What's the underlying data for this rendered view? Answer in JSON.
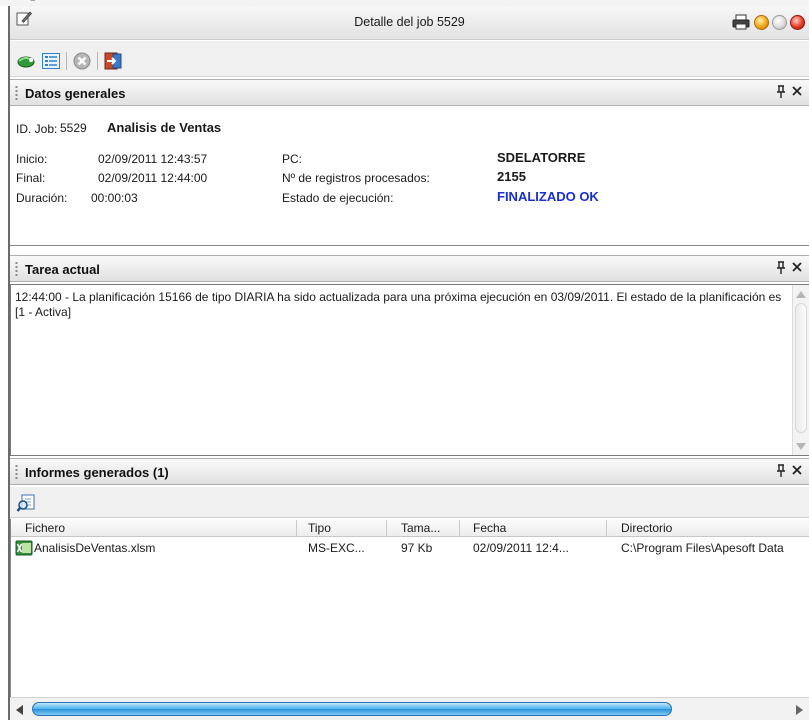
{
  "window": {
    "title": "Detalle del job 5529"
  },
  "toolbar": {
    "buttons": [
      "refresh-icon",
      "list-icon",
      "stop-icon",
      "exit-icon"
    ]
  },
  "datos_generales": {
    "header": "Datos generales",
    "id_job_label": "ID. Job:",
    "id_job_value": "5529",
    "job_name": "Analisis de Ventas",
    "inicio_label": "Inicio:",
    "inicio_value": "02/09/2011 12:43:57",
    "final_label": "Final:",
    "final_value": "02/09/2011 12:44:00",
    "duracion_label": "Duración:",
    "duracion_value": "00:00:03",
    "pc_label": "PC:",
    "pc_value": "SDELATORRE",
    "registros_label": "Nº de registros procesados:",
    "registros_value": "2155",
    "estado_label": "Estado de ejecución:",
    "estado_value": "FINALIZADO OK",
    "estado_color": "#1a2fd2"
  },
  "tarea_actual": {
    "header": "Tarea actual",
    "text": "12:44:00 -  La planificación 15166 de tipo DIARIA ha sido actualizada para una próxima ejecución en 03/09/2011. El estado de la planificación es [1 - Activa]"
  },
  "informes": {
    "header": "Informes generados (1)",
    "columns": [
      "Fichero",
      "Tipo",
      "Tama...",
      "Fecha",
      "Directorio"
    ],
    "rows": [
      {
        "fichero": "AnalisisDeVentas.xlsm",
        "tipo": "MS-EXC...",
        "tamano": "97 Kb",
        "fecha": "02/09/2011 12:4...",
        "directorio": "C:\\Program Files\\Apesoft Data"
      }
    ]
  }
}
